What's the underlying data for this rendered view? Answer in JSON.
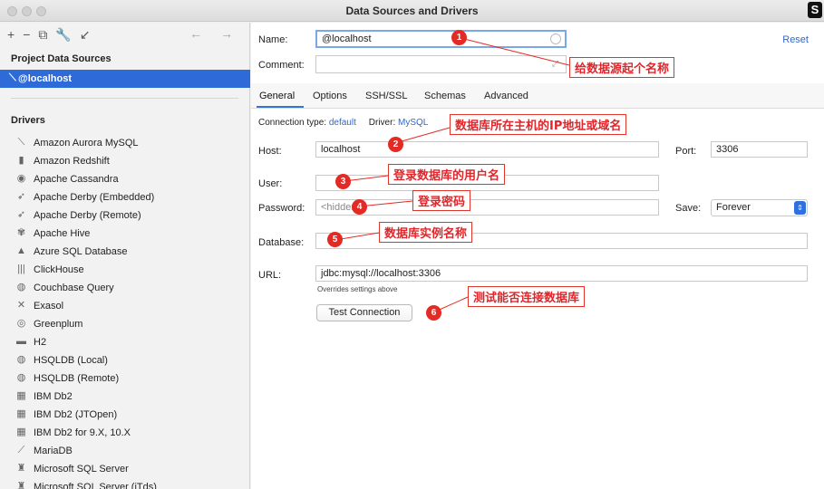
{
  "window": {
    "title": "Data Sources and Drivers",
    "corner_logo": "S"
  },
  "left": {
    "toolbar_icons": [
      "+",
      "−",
      "⧉",
      "🔧",
      "↙"
    ],
    "nav_arrows": "← →",
    "project_header": "Project Data Sources",
    "selected_source": "@localhost",
    "drivers_header": "Drivers",
    "drivers": [
      {
        "label": "Amazon Aurora MySQL",
        "icon": "⟍"
      },
      {
        "label": "Amazon Redshift",
        "icon": "▮"
      },
      {
        "label": "Apache Cassandra",
        "icon": "◉"
      },
      {
        "label": "Apache Derby (Embedded)",
        "icon": "➶"
      },
      {
        "label": "Apache Derby (Remote)",
        "icon": "➶"
      },
      {
        "label": "Apache Hive",
        "icon": "✾"
      },
      {
        "label": "Azure SQL Database",
        "icon": "▲"
      },
      {
        "label": "ClickHouse",
        "icon": "|||"
      },
      {
        "label": "Couchbase Query",
        "icon": "◍"
      },
      {
        "label": "Exasol",
        "icon": "✕"
      },
      {
        "label": "Greenplum",
        "icon": "◎"
      },
      {
        "label": "H2",
        "icon": "▬"
      },
      {
        "label": "HSQLDB (Local)",
        "icon": "◍"
      },
      {
        "label": "HSQLDB (Remote)",
        "icon": "◍"
      },
      {
        "label": "IBM Db2",
        "icon": "▦"
      },
      {
        "label": "IBM Db2 (JTOpen)",
        "icon": "▦"
      },
      {
        "label": "IBM Db2 for 9.X, 10.X",
        "icon": "▦"
      },
      {
        "label": "MariaDB",
        "icon": "⟋"
      },
      {
        "label": "Microsoft SQL Server",
        "icon": "♜"
      },
      {
        "label": "Microsoft SQL Server (jTds)",
        "icon": "♜"
      }
    ]
  },
  "form": {
    "name_label": "Name:",
    "name_value": "@localhost",
    "reset": "Reset",
    "comment_label": "Comment:",
    "comment_value": "",
    "tabs": [
      "General",
      "Options",
      "SSH/SSL",
      "Schemas",
      "Advanced"
    ],
    "connection_type_label": "Connection type:",
    "connection_type_value": "default",
    "driver_label": "Driver:",
    "driver_value": "MySQL",
    "host_label": "Host:",
    "host_value": "localhost",
    "port_label": "Port:",
    "port_value": "3306",
    "user_label": "User:",
    "user_value": "",
    "password_label": "Password:",
    "password_placeholder": "<hidden>",
    "save_label": "Save:",
    "save_value": "Forever",
    "database_label": "Database:",
    "database_value": "",
    "url_label": "URL:",
    "url_value": "jdbc:mysql://localhost:3306",
    "url_note": "Overrides settings above",
    "test_button": "Test Connection"
  },
  "annotations": [
    {
      "num": "1",
      "text": "给数据源起个名称"
    },
    {
      "num": "2",
      "text": "数据库所在主机的IP地址或域名"
    },
    {
      "num": "3",
      "text": "登录数据库的用户名"
    },
    {
      "num": "4",
      "text": "登录密码"
    },
    {
      "num": "5",
      "text": "数据库实例名称"
    },
    {
      "num": "6",
      "text": "测试能否连接数据库"
    }
  ],
  "colors": {
    "accent": "#2e6ad8",
    "annotation_red": "#e42a24",
    "link": "#2f67c9"
  }
}
